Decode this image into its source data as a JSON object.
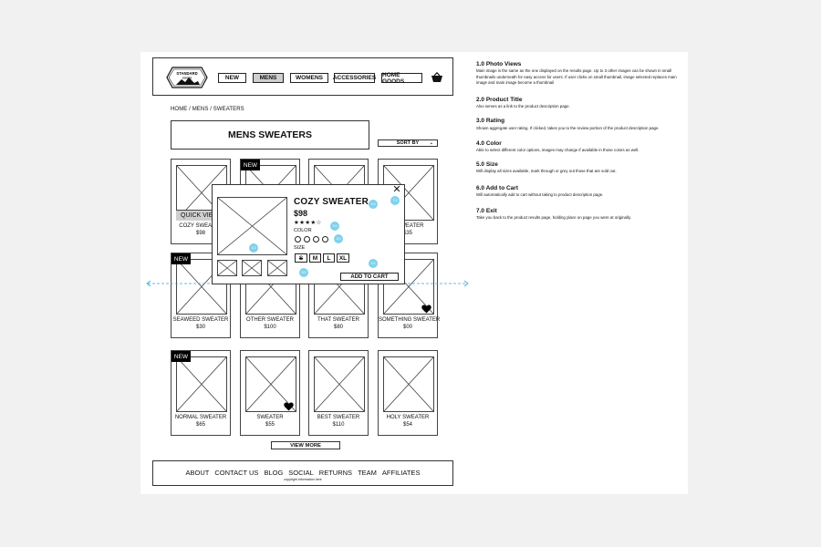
{
  "header": {
    "logo_text": "STANDARD GOODS",
    "nav": [
      "NEW",
      "MENS",
      "WOMENS",
      "ACCESSORIES",
      "HOME GOODS"
    ],
    "active_nav": "MENS",
    "cart_icon": "basket-icon"
  },
  "breadcrumb": "HOME / MENS / SWEATERS",
  "page_title": "MENS SWEATERS",
  "sort_label": "SORT BY",
  "products": [
    {
      "name": "COZY SWEATER",
      "price": "$98",
      "badge": "",
      "quick_view": "QUICK VIEW"
    },
    {
      "name": "",
      "price": "",
      "badge": "NEW"
    },
    {
      "name": "",
      "price": ""
    },
    {
      "name": "E SWEATER",
      "price": "$35"
    },
    {
      "name": "SEAWEED SWEATER",
      "price": "$30",
      "badge": "NEW"
    },
    {
      "name": "OTHER SWEATER",
      "price": "$100"
    },
    {
      "name": "THAT SWEATER",
      "price": "$80"
    },
    {
      "name": "SOMETHING SWEATER",
      "price": "$00",
      "heart": true
    },
    {
      "name": "NORMAL SWEATER",
      "price": "$65",
      "badge": "NEW"
    },
    {
      "name": "SWEATER",
      "price": "$55",
      "heart": true
    },
    {
      "name": "BEST SWEATER",
      "price": "$110"
    },
    {
      "name": "HOLY SWEATER",
      "price": "$54"
    }
  ],
  "view_more": "VIEW MORE",
  "footer": {
    "links": [
      "ABOUT",
      "CONTACT US",
      "BLOG",
      "SOCIAL",
      "RETURNS",
      "TEAM",
      "AFFILIATES"
    ],
    "copyright": "copyright information here"
  },
  "modal": {
    "title": "COZY SWEATER",
    "price": "$98",
    "rating": 3.5,
    "rating_stars": "★★★★☆",
    "color_label": "COLOR",
    "color_count": 4,
    "size_label": "SIZE",
    "sizes": [
      "S",
      "M",
      "L",
      "XL"
    ],
    "sold_out_size": "S",
    "add_to_cart": "ADD TO CART",
    "close_icon": "close-icon",
    "markers": [
      "1.0",
      "2.0",
      "3.0",
      "4.0",
      "5.0",
      "6.0",
      "7.0"
    ]
  },
  "annotations": [
    {
      "title": "1.0 Photo Views",
      "body": "Main image is the same as the one displayed on the results page. Up to 3 other images can be shown in small thumbnails underneath for easy access for users. If user clicks on small thumbnail, image selected replaces main image and main image become a thumbnail"
    },
    {
      "title": "2.0 Product Title",
      "body": "Also serves as a link to the product description page."
    },
    {
      "title": "3.0 Rating",
      "body": "Shown aggregate user rating. If clicked, takes you to the review portion of the product description page."
    },
    {
      "title": "4.0 Color",
      "body": "Able to select different color options, images may change if available in those colors as well."
    },
    {
      "title": "5.0  Size",
      "body": "Will display all sizes available, mark through or grey out those that are sold out."
    },
    {
      "title": "6.0  Add to Cart",
      "body": "Will automatically add to cart without taking to product description page."
    },
    {
      "title": "7.0  Exit",
      "body": "Take you back to the product results page, holding place on page you were at originally."
    }
  ],
  "colors": {
    "accent": "#7fd2ec",
    "fold_line": "#3aa8d8",
    "active_nav": "#cfcfcf"
  }
}
